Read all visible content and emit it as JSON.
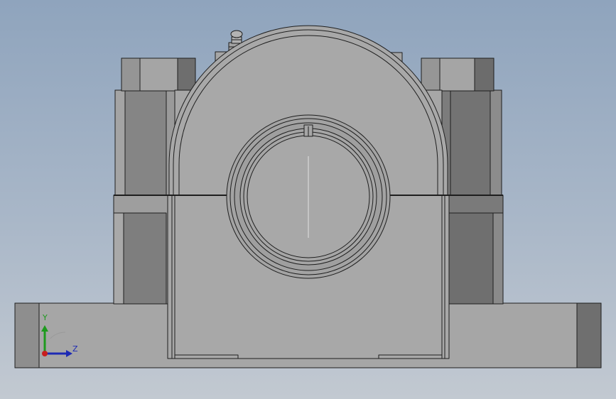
{
  "viewport": {
    "background_top": "#8fa4bd",
    "background_bottom": "#c2c9d1",
    "part_color": "#a6a6a6",
    "edge_color": "#1e1e1e"
  },
  "triad": {
    "y_label": "Y",
    "z_label": "Z",
    "y_color": "#1e9a1e",
    "z_color": "#1d2ab4",
    "x_color": "#c81e1e"
  }
}
